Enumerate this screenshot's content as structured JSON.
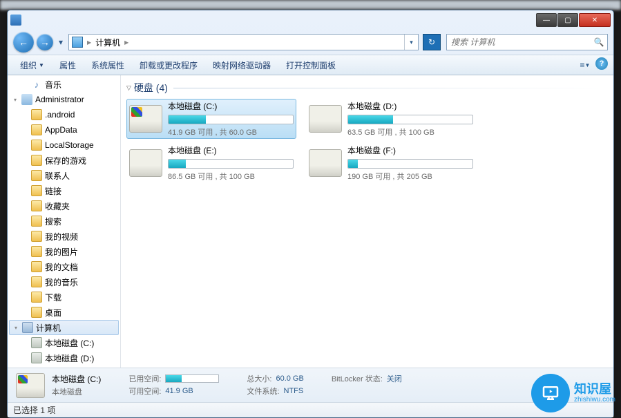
{
  "title": "计算机",
  "window_controls": {
    "min": "—",
    "max": "▢",
    "close": "✕"
  },
  "nav": {
    "back": "←",
    "fwd": "→"
  },
  "address": {
    "crumbs": [
      "计算机"
    ],
    "separator": "▶",
    "refresh": "↻",
    "dropdown": "▾"
  },
  "search": {
    "placeholder": "搜索 计算机",
    "icon": "🔍"
  },
  "toolbar": {
    "organize": "组织",
    "props": "属性",
    "sysprops": "系统属性",
    "uninstall": "卸载或更改程序",
    "mapnet": "映射网络驱动器",
    "ctrlpanel": "打开控制面板",
    "view": "≡",
    "help": "?"
  },
  "sidebar": [
    {
      "label": "音乐",
      "icon": "music",
      "level": 1
    },
    {
      "label": "Administrator",
      "icon": "user",
      "level": 0,
      "exp": "▾"
    },
    {
      "label": ".android",
      "icon": "folder",
      "level": 1
    },
    {
      "label": "AppData",
      "icon": "folder",
      "level": 1
    },
    {
      "label": "LocalStorage",
      "icon": "folder",
      "level": 1
    },
    {
      "label": "保存的游戏",
      "icon": "folder",
      "level": 1
    },
    {
      "label": "联系人",
      "icon": "folder",
      "level": 1
    },
    {
      "label": "链接",
      "icon": "folder",
      "level": 1
    },
    {
      "label": "收藏夹",
      "icon": "folder",
      "level": 1
    },
    {
      "label": "搜索",
      "icon": "folder",
      "level": 1
    },
    {
      "label": "我的视频",
      "icon": "folder",
      "level": 1
    },
    {
      "label": "我的图片",
      "icon": "folder",
      "level": 1
    },
    {
      "label": "我的文档",
      "icon": "folder",
      "level": 1
    },
    {
      "label": "我的音乐",
      "icon": "folder",
      "level": 1
    },
    {
      "label": "下载",
      "icon": "folder",
      "level": 1
    },
    {
      "label": "桌面",
      "icon": "folder",
      "level": 1
    },
    {
      "label": "计算机",
      "icon": "computer",
      "level": 0,
      "sel": true,
      "exp": "▾"
    },
    {
      "label": "本地磁盘 (C:)",
      "icon": "drive",
      "level": 1
    },
    {
      "label": "本地磁盘 (D:)",
      "icon": "drive",
      "level": 1
    }
  ],
  "main": {
    "section_label": "硬盘 (4)",
    "drives": [
      {
        "name": "本地磁盘 (C:)",
        "info": "41.9 GB 可用 , 共 60.0 GB",
        "fill": 30,
        "sys": true,
        "sel": true
      },
      {
        "name": "本地磁盘 (D:)",
        "info": "63.5 GB 可用 , 共 100 GB",
        "fill": 36,
        "sys": false,
        "sel": false
      },
      {
        "name": "本地磁盘 (E:)",
        "info": "86.5 GB 可用 , 共 100 GB",
        "fill": 14,
        "sys": false,
        "sel": false
      },
      {
        "name": "本地磁盘 (F:)",
        "info": "190 GB 可用 , 共 205 GB",
        "fill": 8,
        "sys": false,
        "sel": false
      }
    ]
  },
  "details": {
    "title": "本地磁盘 (C:)",
    "subtitle": "本地磁盘",
    "used_label": "已用空间:",
    "free_label": "可用空间:",
    "free_value": "41.9 GB",
    "total_label": "总大小:",
    "total_value": "60.0 GB",
    "fs_label": "文件系统:",
    "fs_value": "NTFS",
    "bitlocker_label": "BitLocker 状态:",
    "bitlocker_value": "关闭",
    "used_fill": 30
  },
  "statusbar": {
    "text": "已选择 1 项"
  },
  "watermark": {
    "text": "知识屋",
    "sub": "zhishiwu.com"
  }
}
